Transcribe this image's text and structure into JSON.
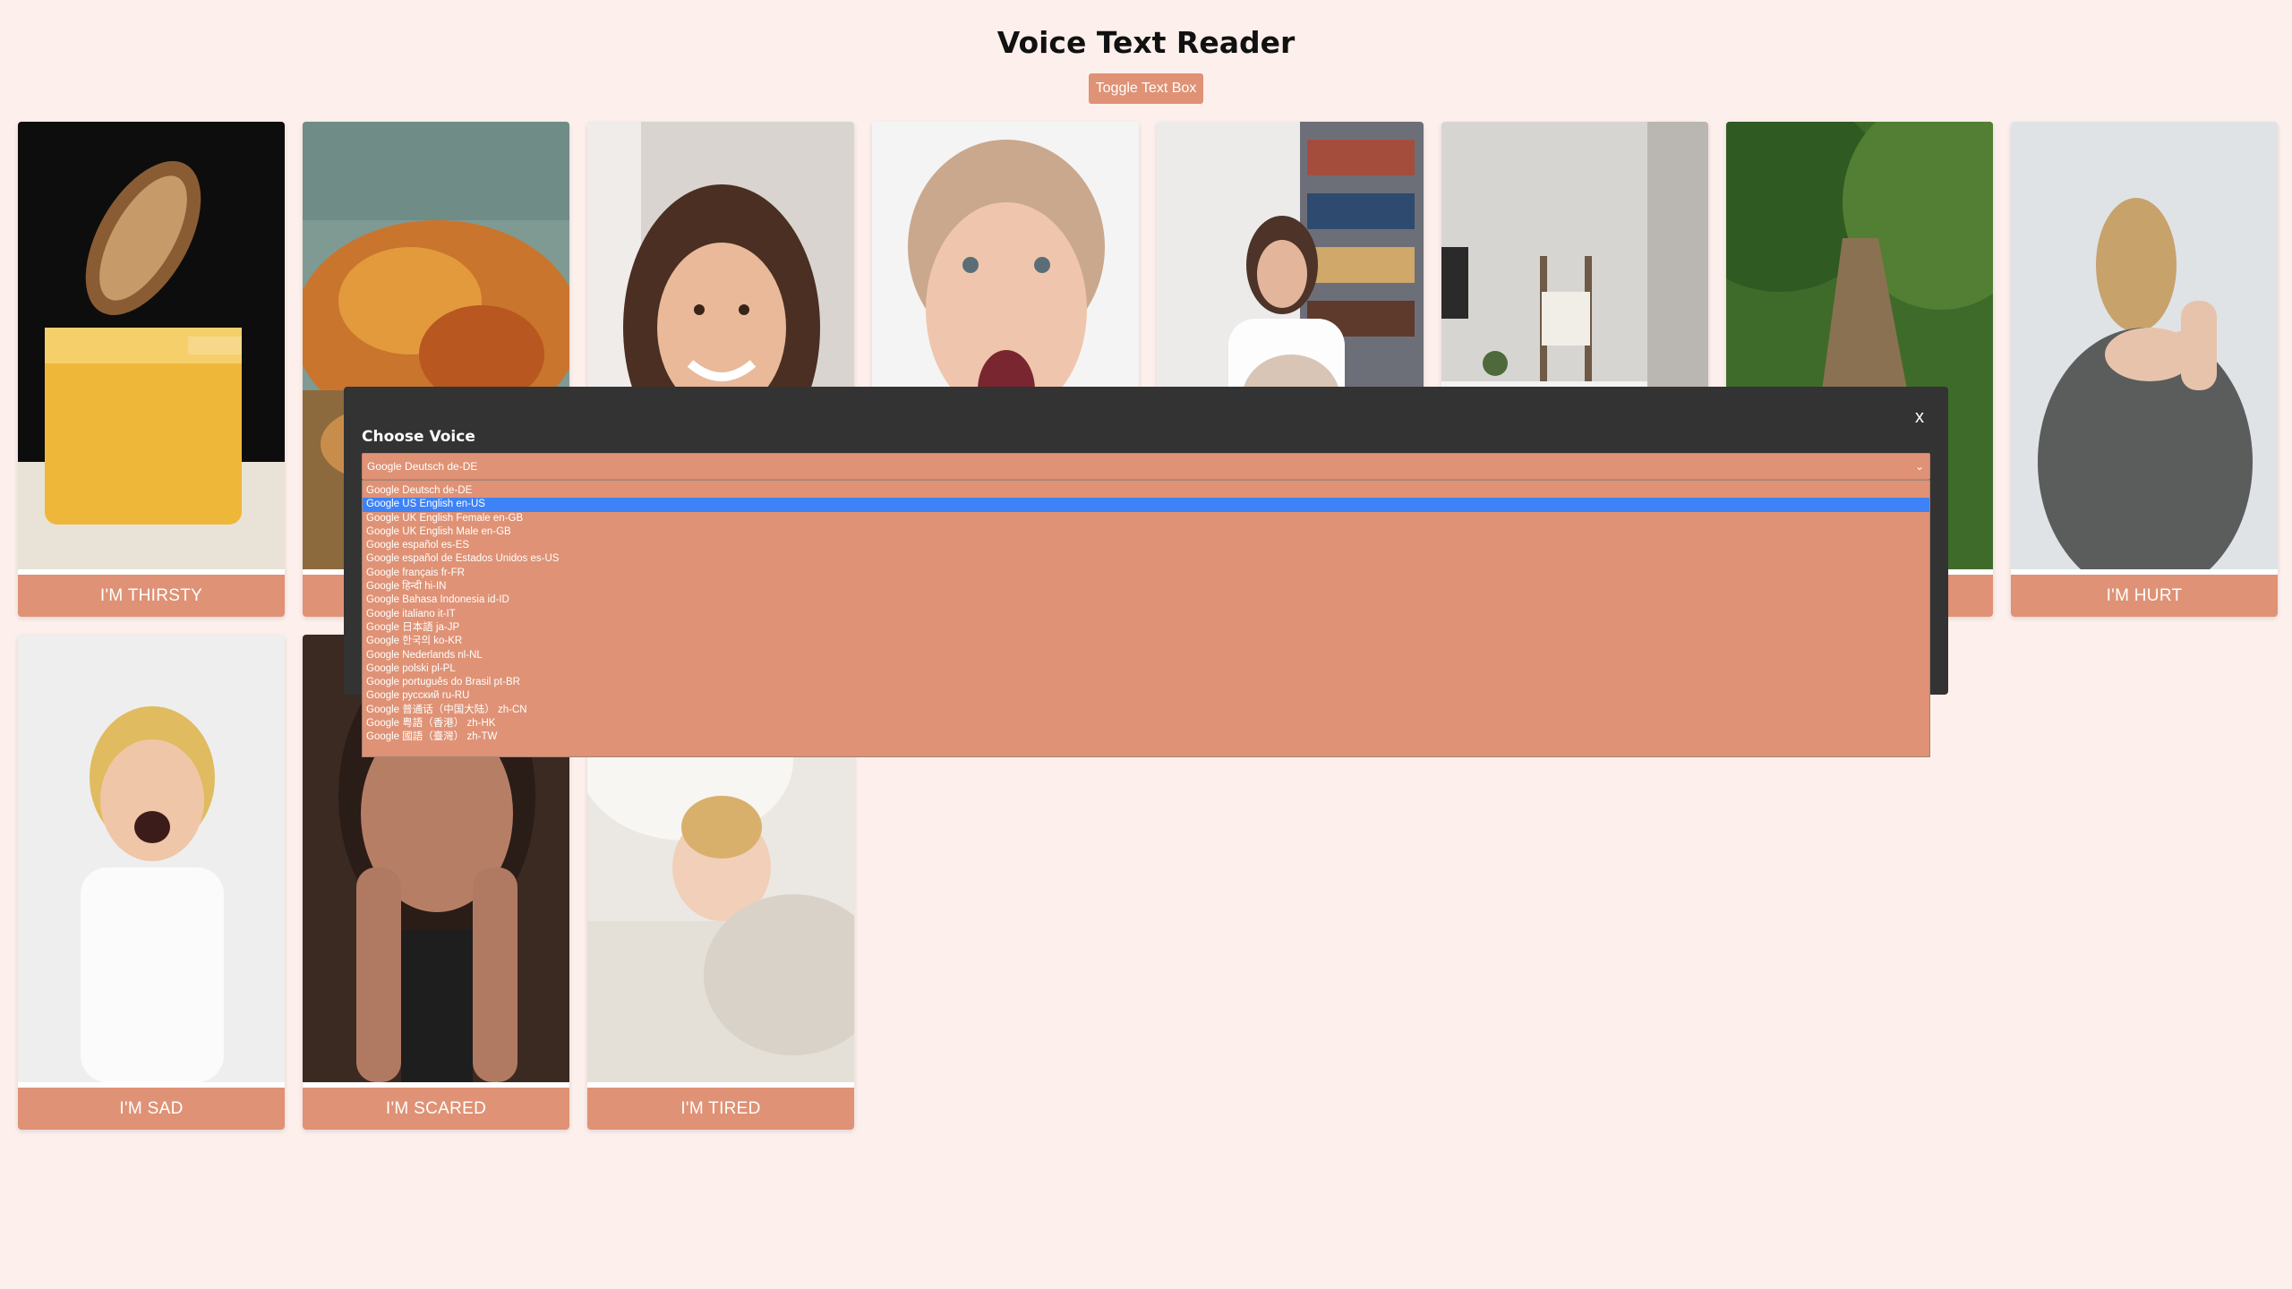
{
  "header": {
    "title": "Voice Text Reader",
    "toggle_label": "Toggle Text Box"
  },
  "cards": [
    {
      "label": "I'M THIRSTY",
      "image": "lemon-drink-photo"
    },
    {
      "label": "",
      "image": "chips-photo"
    },
    {
      "label": "",
      "image": "smiling-woman-photo"
    },
    {
      "label": "",
      "image": "screaming-woman-photo"
    },
    {
      "label": "",
      "image": "playful-women-photo"
    },
    {
      "label": "",
      "image": "room-ladder-photo"
    },
    {
      "label": "",
      "image": "park-path-photo"
    },
    {
      "label": "I'M HURT",
      "image": "shoulder-pain-photo"
    },
    {
      "label": "I'M SAD",
      "image": "crying-boy-photo"
    },
    {
      "label": "I'M SCARED",
      "image": "hiding-face-photo"
    },
    {
      "label": "I'M TIRED",
      "image": "sleeping-girl-photo"
    }
  ],
  "modal": {
    "close_label": "x",
    "heading": "Choose Voice",
    "selected_voice": "Google Deutsch de-DE",
    "highlighted_option": "Google US English en-US",
    "options": [
      "Google Deutsch de-DE",
      "Google US English en-US",
      "Google UK English Female en-GB",
      "Google UK English Male en-GB",
      "Google español es-ES",
      "Google español de Estados Unidos es-US",
      "Google français fr-FR",
      "Google हिन्दी hi-IN",
      "Google Bahasa Indonesia id-ID",
      "Google italiano it-IT",
      "Google 日本語 ja-JP",
      "Google 한국의 ko-KR",
      "Google Nederlands nl-NL",
      "Google polski pl-PL",
      "Google português do Brasil pt-BR",
      "Google русский ru-RU",
      "Google 普通话（中国大陆） zh-CN",
      "Google 粤語（香港） zh-HK",
      "Google 國語（臺灣） zh-TW"
    ]
  },
  "colors": {
    "background": "#fdf0ec",
    "accent": "#df9275",
    "modal": "#333333",
    "highlight": "#3e82f7"
  }
}
